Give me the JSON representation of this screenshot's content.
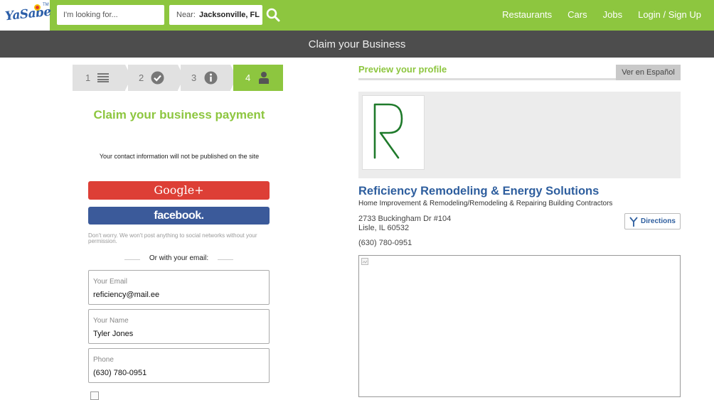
{
  "header": {
    "logo_text": "YaSabe",
    "logo_tm": "TM",
    "search_placeholder": "I'm looking for...",
    "near_label": "Near:",
    "near_value": "Jacksonville, FL",
    "nav": [
      "Restaurants",
      "Cars",
      "Jobs",
      "Login / Sign Up"
    ]
  },
  "page_title": "Claim your Business",
  "steps": [
    {
      "num": "1",
      "icon": "list-icon"
    },
    {
      "num": "2",
      "icon": "check-circle-icon"
    },
    {
      "num": "3",
      "icon": "info-circle-icon"
    },
    {
      "num": "4",
      "icon": "user-icon"
    }
  ],
  "form": {
    "title": "Claim your business payment",
    "contact_note": "Your contact information will not be published on the site",
    "google_label": "Google+",
    "facebook_label": "facebook.",
    "social_note": "Don't worry. We won't post anything to social networks without your permission.",
    "or_email": "Or with your email:",
    "fields": [
      {
        "label": "Your Email",
        "value": "reficiency@mail.ee"
      },
      {
        "label": "Your Name",
        "value": "Tyler Jones"
      },
      {
        "label": "Phone",
        "value": "(630) 780-0951"
      }
    ]
  },
  "preview": {
    "title": "Preview your profile",
    "language_button": "Ver en Español",
    "business_name": "Reficiency Remodeling & Energy Solutions",
    "categories": "Home Improvement & Remodeling/Remodeling & Repairing Building Contractors",
    "address_line1": "2733 Buckingham Dr #104",
    "address_line2": "Lisle, IL   60532",
    "phone": "(630) 780-0951",
    "directions_label": "Directions",
    "logo_letter": "R"
  },
  "colors": {
    "brand_green": "#8dc63f",
    "title_bar": "#4d4d4d",
    "link_blue": "#2e5e9e",
    "google_red": "#dd3f36",
    "facebook_blue": "#3b5a9a"
  }
}
